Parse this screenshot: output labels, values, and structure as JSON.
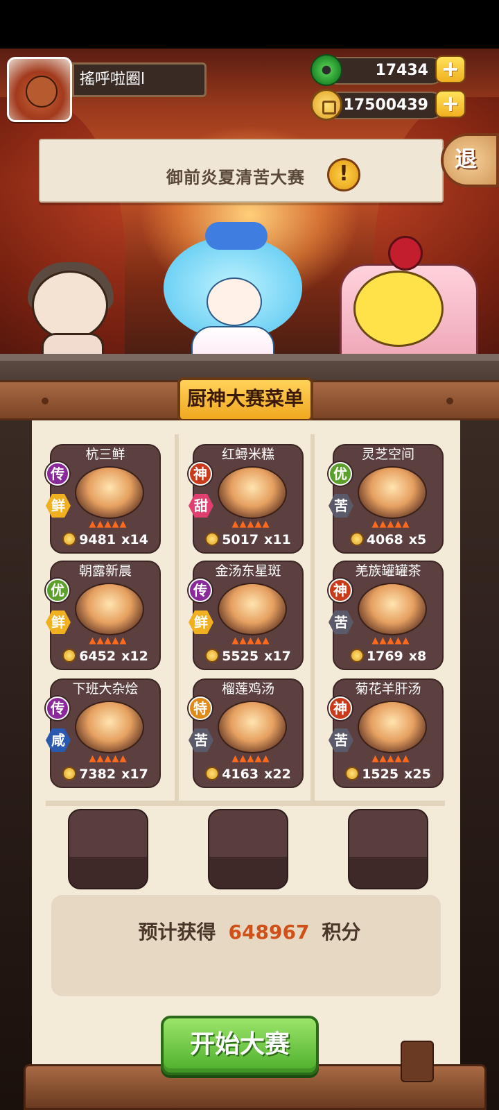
{
  "player": {
    "name": "搖呼啦圈l",
    "jade": "17434",
    "coins": "17500439"
  },
  "event": {
    "title": "御前炎夏清苦大赛",
    "exit_label": "退"
  },
  "menu": {
    "title": "厨神大赛菜单",
    "dishes": [
      {
        "name": "杭三鲜",
        "rank": "传",
        "flavor": "鲜",
        "price": "9481",
        "qty": "x14",
        "rank_color": "#8a2a9a",
        "flavor_color": "#f0b020"
      },
      {
        "name": "红蟳米糕",
        "rank": "神",
        "flavor": "甜",
        "price": "5017",
        "qty": "x11",
        "rank_color": "#c83a1a",
        "flavor_color": "#e04070"
      },
      {
        "name": "灵芝空间",
        "rank": "优",
        "flavor": "苦",
        "price": "4068",
        "qty": "x5",
        "rank_color": "#5aa02a",
        "flavor_color": "#5a5a6a"
      },
      {
        "name": "朝露新晨",
        "rank": "优",
        "flavor": "鲜",
        "price": "6452",
        "qty": "x12",
        "rank_color": "#5aa02a",
        "flavor_color": "#f0b020"
      },
      {
        "name": "金汤东星斑",
        "rank": "传",
        "flavor": "鲜",
        "price": "5525",
        "qty": "x17",
        "rank_color": "#8a2a9a",
        "flavor_color": "#f0b020"
      },
      {
        "name": "羌族罐罐茶",
        "rank": "神",
        "flavor": "苦",
        "price": "1769",
        "qty": "x8",
        "rank_color": "#c83a1a",
        "flavor_color": "#5a5a6a"
      },
      {
        "name": "下班大杂烩",
        "rank": "传",
        "flavor": "咸",
        "price": "7382",
        "qty": "x17",
        "rank_color": "#8a2a9a",
        "flavor_color": "#2a5ab0"
      },
      {
        "name": "榴莲鸡汤",
        "rank": "特",
        "flavor": "苦",
        "price": "4163",
        "qty": "x22",
        "rank_color": "#e08a1a",
        "flavor_color": "#5a5a6a"
      },
      {
        "name": "菊花羊肝汤",
        "rank": "神",
        "flavor": "苦",
        "price": "1525",
        "qty": "x25",
        "rank_color": "#c83a1a",
        "flavor_color": "#5a5a6a"
      }
    ]
  },
  "estimate": {
    "prefix": "预计获得",
    "value": "648967",
    "suffix": "积分"
  },
  "start_button": "开始大赛",
  "colors": {
    "accent": "#d0501a",
    "start_green": "#4cae2a",
    "card_bg": "#5c4040"
  },
  "icons": {
    "alert": "exclamation-icon",
    "plus": "plus-icon",
    "jade": "jade-icon",
    "coin": "coin-icon"
  }
}
